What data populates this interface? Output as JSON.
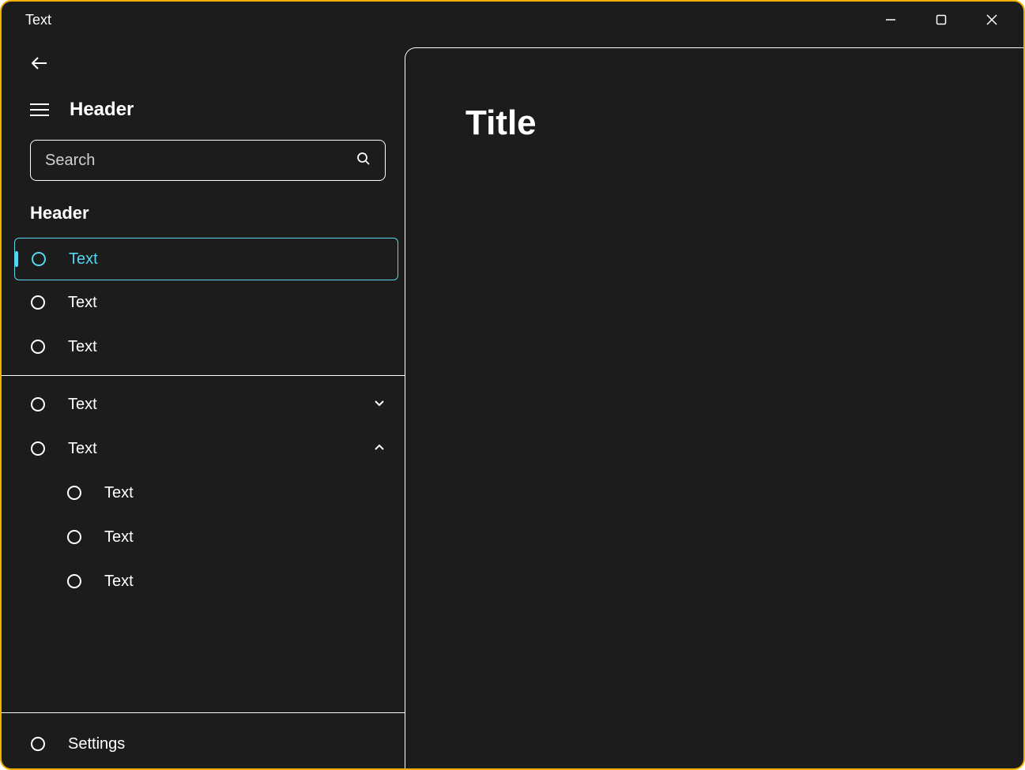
{
  "window": {
    "title": "Text"
  },
  "sidebar": {
    "header_label": "Header",
    "search": {
      "placeholder": "Search"
    },
    "section_header": "Header",
    "items_a": [
      {
        "label": "Text",
        "selected": true
      },
      {
        "label": "Text"
      },
      {
        "label": "Text"
      }
    ],
    "items_b": [
      {
        "label": "Text",
        "expand": "down"
      },
      {
        "label": "Text",
        "expand": "up",
        "children": [
          {
            "label": "Text"
          },
          {
            "label": "Text"
          },
          {
            "label": "Text"
          }
        ]
      }
    ],
    "footer_item": {
      "label": "Settings"
    }
  },
  "content": {
    "title": "Title"
  }
}
